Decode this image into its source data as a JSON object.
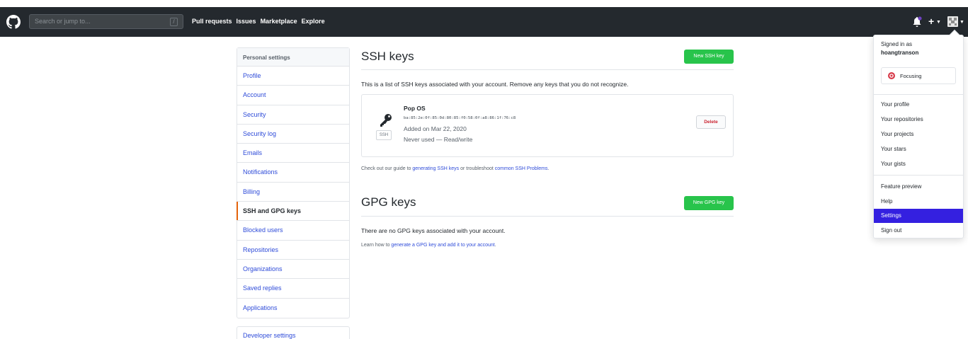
{
  "header": {
    "search_placeholder": "Search or jump to...",
    "search_shortcut": "/",
    "nav": [
      "Pull requests",
      "Issues",
      "Marketplace",
      "Explore"
    ],
    "plus": "+"
  },
  "sidebar": {
    "heading": "Personal settings",
    "items": [
      {
        "label": "Profile"
      },
      {
        "label": "Account"
      },
      {
        "label": "Security"
      },
      {
        "label": "Security log"
      },
      {
        "label": "Emails"
      },
      {
        "label": "Notifications"
      },
      {
        "label": "Billing"
      },
      {
        "label": "SSH and GPG keys",
        "selected": true
      },
      {
        "label": "Blocked users"
      },
      {
        "label": "Repositories"
      },
      {
        "label": "Organizations"
      },
      {
        "label": "Saved replies"
      },
      {
        "label": "Applications"
      }
    ],
    "developer": "Developer settings"
  },
  "ssh": {
    "title": "SSH keys",
    "new_button": "New SSH key",
    "description": "This is a list of SSH keys associated with your account. Remove any keys that you do not recognize.",
    "key": {
      "title": "Pop OS",
      "fingerprint": "ba:85:2e:0f:85:0d:80:85:f0:58:0f:a8:86:1f:76:c8",
      "added": "Added on Mar 22, 2020",
      "usage": "Never used — Read/write",
      "badge": "SSH",
      "delete": "Delete"
    },
    "guide_prefix": "Check out our guide to ",
    "guide_link1": "generating SSH keys",
    "guide_mid": " or troubleshoot ",
    "guide_link2": "common SSH Problems",
    "guide_suffix": "."
  },
  "gpg": {
    "title": "GPG keys",
    "new_button": "New GPG key",
    "empty": "There are no GPG keys associated with your account.",
    "learn_prefix": "Learn how to ",
    "learn_link": "generate a GPG key and add it to your account",
    "learn_suffix": "."
  },
  "dropdown": {
    "signed_in_as": "Signed in as",
    "username": "hoangtranson",
    "status": "Focusing",
    "group1": [
      "Your profile",
      "Your repositories",
      "Your projects",
      "Your stars",
      "Your gists"
    ],
    "group2": [
      "Feature preview",
      "Help",
      "Settings",
      "Sign out"
    ],
    "active": "Settings"
  },
  "colors": {
    "header_bg": "#24292e",
    "link": "#2f4cd9",
    "green": "#28c44b",
    "selected_border": "#e36209",
    "dropdown_active": "#3420e0",
    "danger": "#cb2431"
  },
  "icons": [
    "github-logo-icon",
    "bell-icon",
    "plus-icon",
    "avatar",
    "key-icon",
    "focus-status-icon"
  ]
}
